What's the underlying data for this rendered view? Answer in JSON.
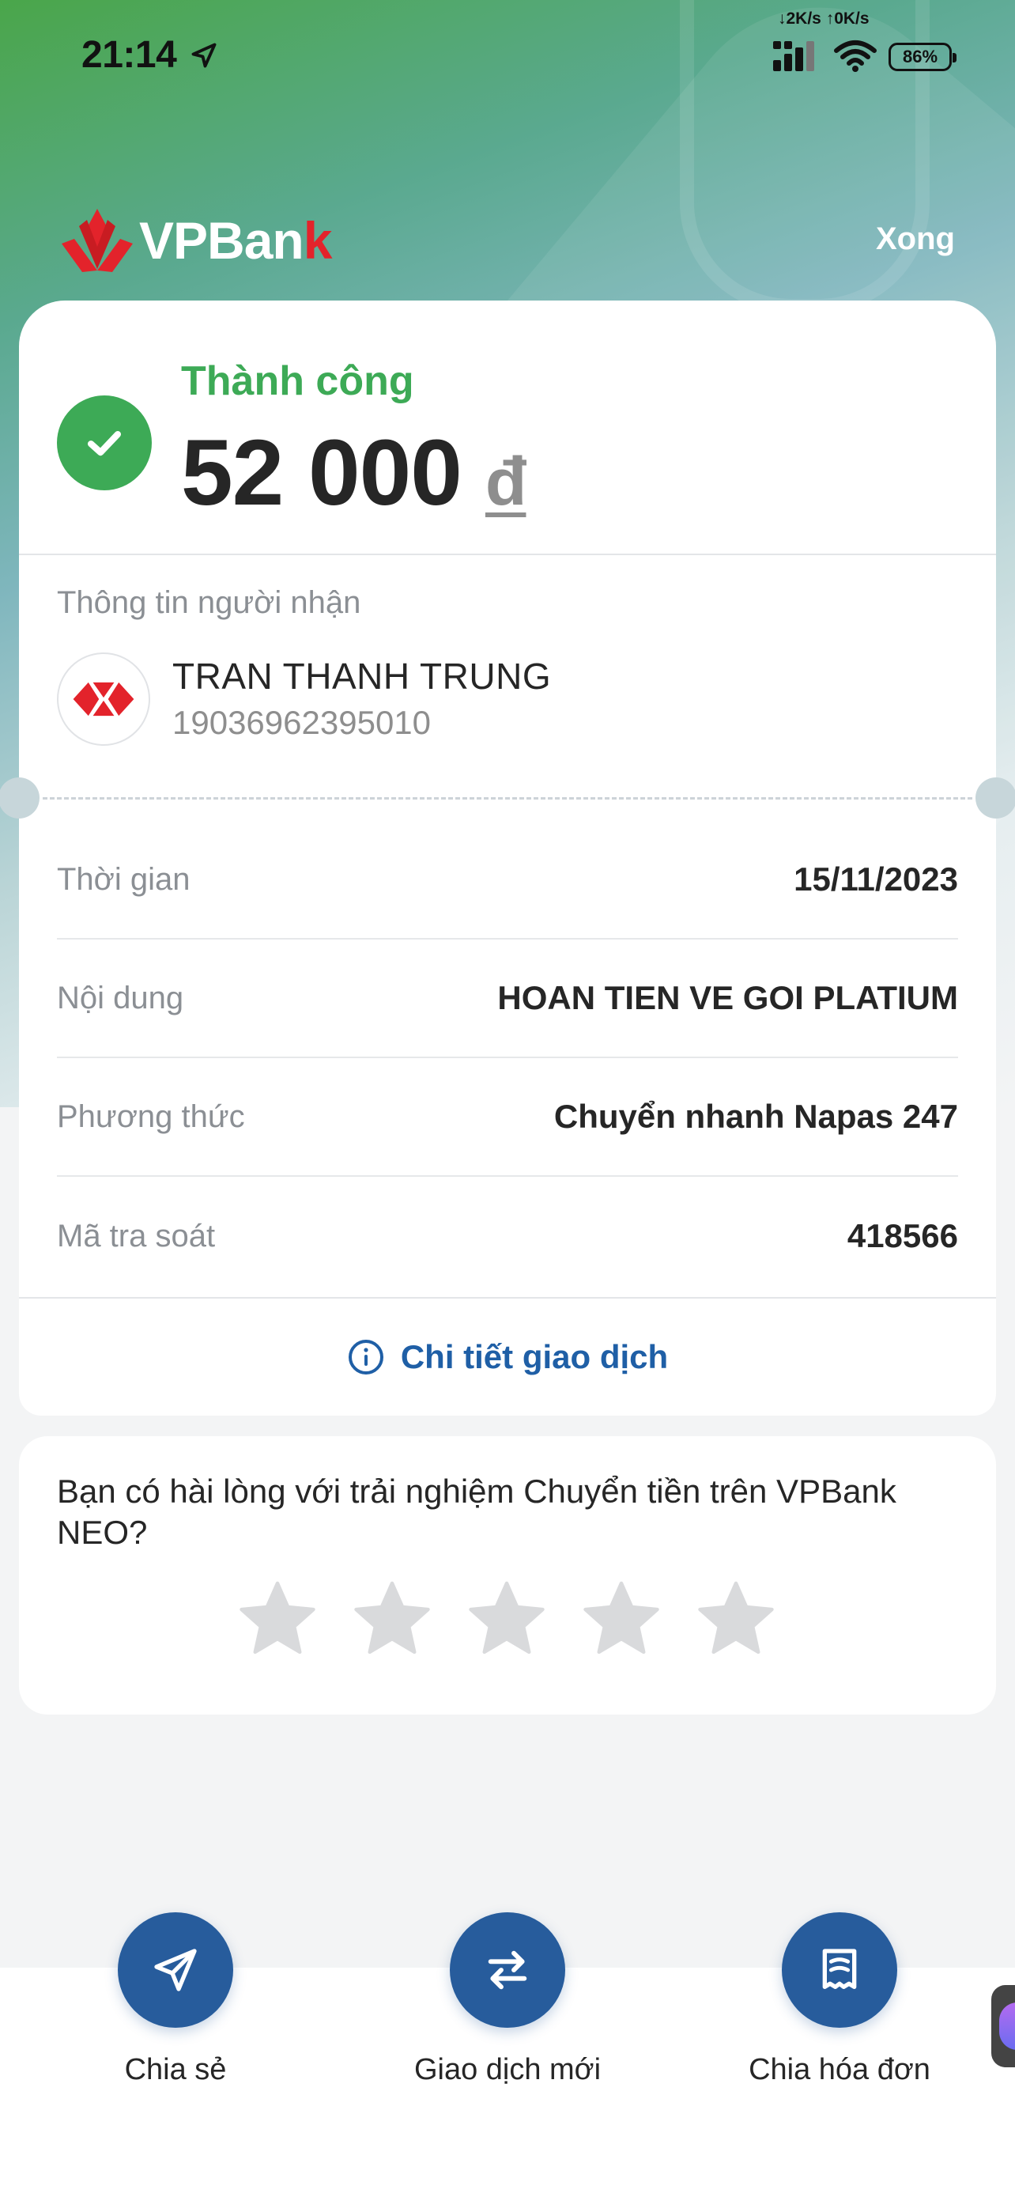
{
  "status_bar": {
    "time": "21:14",
    "net_speed": "↓2K/s ↑0K/s",
    "battery": "86%"
  },
  "header": {
    "brand_name": "VPBan",
    "brand_name_accent": "k",
    "done_label": "Xong"
  },
  "result": {
    "status": "Thành công",
    "amount": "52 000",
    "currency": "đ"
  },
  "recipient": {
    "section_title": "Thông tin người nhận",
    "name": "TRAN THANH TRUNG",
    "account": "19036962395010"
  },
  "details": [
    {
      "label": "Thời gian",
      "value": "15/11/2023"
    },
    {
      "label": "Nội dung",
      "value": "HOAN TIEN VE GOI PLATIUM"
    },
    {
      "label": "Phương thức",
      "value": "Chuyển nhanh Napas 247"
    },
    {
      "label": "Mã tra soát",
      "value": "418566"
    }
  ],
  "detail_link": "Chi tiết giao dịch",
  "rating": {
    "question": "Bạn có hài lòng với trải nghiệm Chuyển tiền trên VPBank NEO?",
    "stars_selected": 0,
    "stars_total": 5
  },
  "actions": [
    {
      "label": "Chia sẻ",
      "icon": "send-icon"
    },
    {
      "label": "Giao dịch mới",
      "icon": "transfer-arrows-icon"
    },
    {
      "label": "Chia hóa đơn",
      "icon": "bill-split-icon"
    }
  ],
  "colors": {
    "success": "#3daa56",
    "primary": "#275c9c",
    "link": "#1f5fa6",
    "brand_red": "#e3232b"
  }
}
